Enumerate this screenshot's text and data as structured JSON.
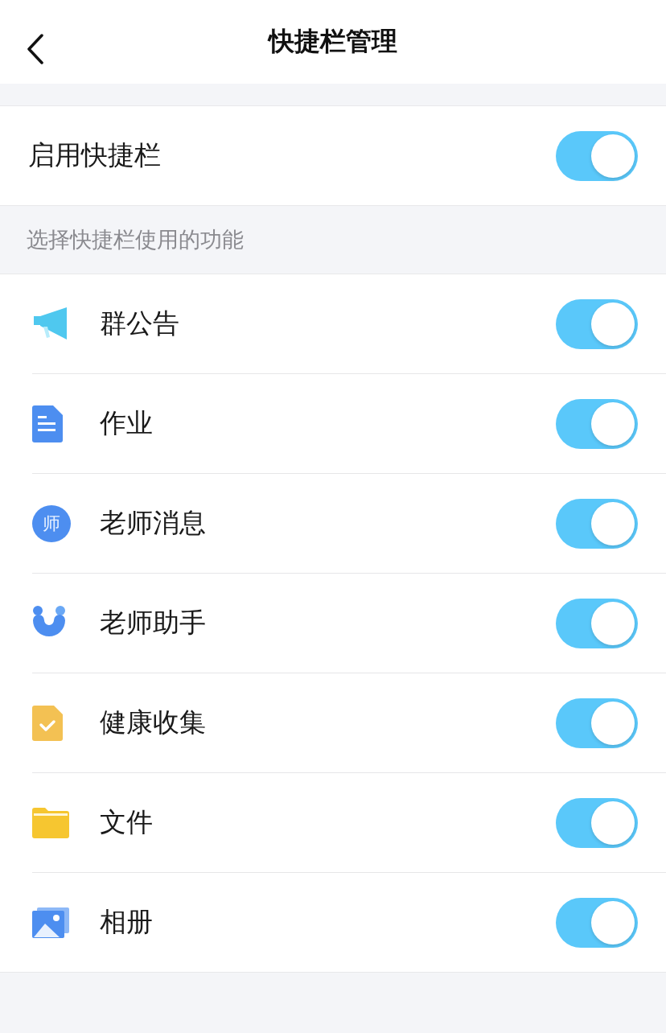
{
  "header": {
    "title": "快捷栏管理"
  },
  "master": {
    "label": "启用快捷栏",
    "on": true
  },
  "section_label": "选择快捷栏使用的功能",
  "items": [
    {
      "kind": "megaphone",
      "label": "群公告",
      "on": true
    },
    {
      "kind": "document",
      "label": "作业",
      "on": true
    },
    {
      "kind": "bubble",
      "icon_text": "师",
      "label": "老师消息",
      "on": true
    },
    {
      "kind": "smile",
      "label": "老师助手",
      "on": true
    },
    {
      "kind": "checkfile",
      "label": "健康收集",
      "on": true
    },
    {
      "kind": "folder",
      "label": "文件",
      "on": true
    },
    {
      "kind": "photo",
      "label": "相册",
      "on": true
    }
  ]
}
